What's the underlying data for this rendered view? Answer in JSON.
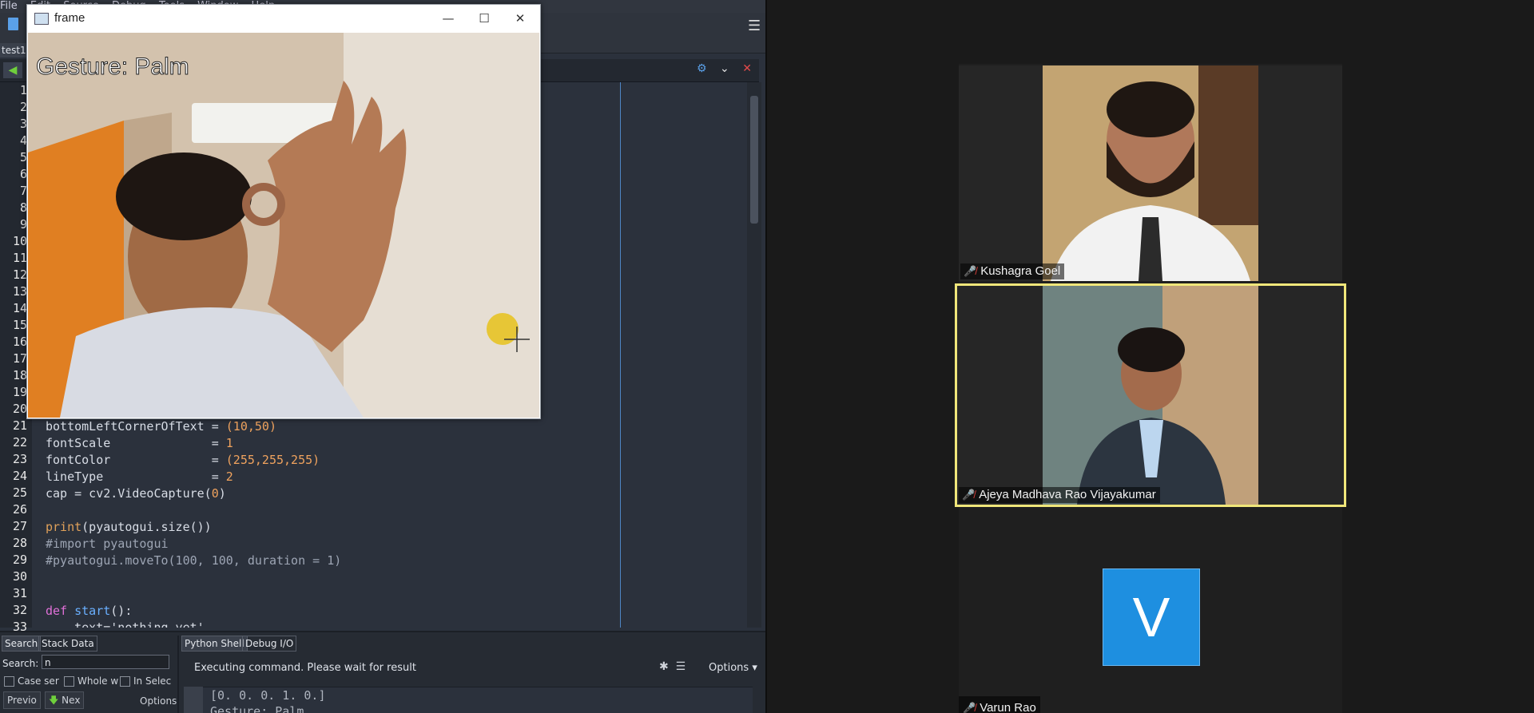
{
  "ide": {
    "menu": [
      "File",
      "Edit",
      "Source",
      "Debug",
      "Tools",
      "Window",
      "Help"
    ],
    "file_tab": "test1",
    "line_numbers": [
      "1",
      "2",
      "3",
      "4",
      "5",
      "6",
      "7",
      "8",
      "9",
      "10",
      "11",
      "12",
      "13",
      "14",
      "15",
      "16",
      "17",
      "18",
      "19",
      "20",
      "21",
      "22",
      "23",
      "24",
      "25",
      "26",
      "27",
      "28",
      "29",
      "30",
      "31",
      "32",
      "33"
    ],
    "code": {
      "l21_a": "bottomLeftCornerOfText = ",
      "l21_b": "(10,50)",
      "l22_a": "fontScale              = ",
      "l22_b": "1",
      "l23_a": "fontColor              = ",
      "l23_b": "(255,255,255)",
      "l24_a": "lineType               = ",
      "l24_b": "2",
      "l25_a": "cap = cv2.VideoCapture(",
      "l25_b": "0",
      "l25_c": ")",
      "l27_a": "print",
      "l27_b": "(pyautogui.size())",
      "l28": "#import pyautogui",
      "l29": "#pyautogui.moveTo(100, 100, duration = 1)",
      "l32_a": "def ",
      "l32_b": "start",
      "l32_c": "():",
      "l33": "    text='nothing yet'"
    },
    "panels": {
      "search_tab": "Search",
      "stack_tab": "Stack Data",
      "python_shell_tab": "Python Shell",
      "debug_io_tab": "Debug I/O",
      "search_label": "Search:",
      "search_value": "n",
      "case_sensitive": "Case ser",
      "whole_word": "Whole w",
      "in_selection": "In Selec",
      "previous": "Previo",
      "next": "Nex",
      "search_options": "Options",
      "status": "Executing command.  Please wait for result",
      "shell_options": "Options",
      "shell_line1": "[0. 0. 0. 1. 0.]",
      "shell_line2": "Gesture: Palm"
    }
  },
  "frame_window": {
    "title": "frame",
    "overlay_text": "Gesture: Palm"
  },
  "zoom": {
    "participants": [
      {
        "name": "Kushagra Goel",
        "muted": true,
        "active_speaker": false
      },
      {
        "name": "Ajeya Madhava Rao Vijayakumar",
        "muted": true,
        "active_speaker": true
      },
      {
        "name": "Varun Rao",
        "muted": true,
        "active_speaker": false,
        "avatar_letter": "V"
      }
    ],
    "active_speaker_border": "#f0e67a",
    "avatar_color": "#1e8fe0",
    "mute_icon_color": "#e0413b"
  },
  "ide_colors": {
    "number": "#f0a35e",
    "keyword": "#e070d8",
    "function": "#6ab0ff",
    "comment": "#9da5b4"
  }
}
